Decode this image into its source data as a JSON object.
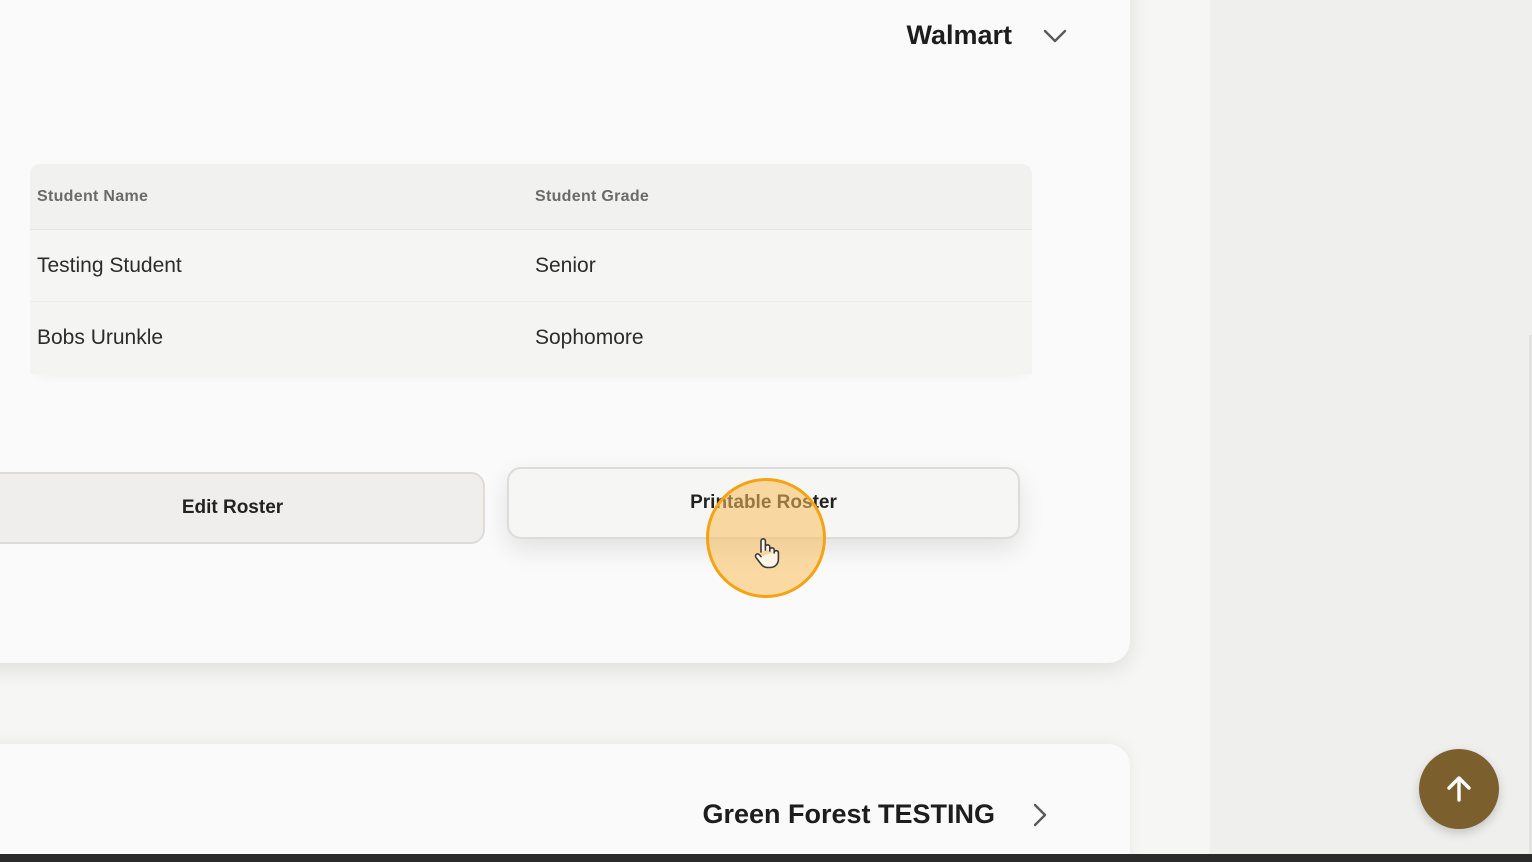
{
  "roster_card": {
    "title": "Walmart",
    "table": {
      "headers": [
        "Student Name",
        "Student Grade"
      ],
      "rows": [
        [
          "Testing Student",
          "Senior"
        ],
        [
          "Bobs Urunkle",
          "Sophomore"
        ]
      ]
    },
    "edit_button": "Edit Roster",
    "print_button": "Printable Roster"
  },
  "second_card": {
    "title": "Green Forest TESTING"
  },
  "icons": {
    "expanded": "chevron-down-icon",
    "collapsed": "chevron-right-icon",
    "scroll_top": "arrow-up-icon",
    "cursor": "hand-pointer-icon"
  },
  "colors": {
    "accent": "#7b5f2d",
    "cursor_highlight": "#f5a214"
  }
}
